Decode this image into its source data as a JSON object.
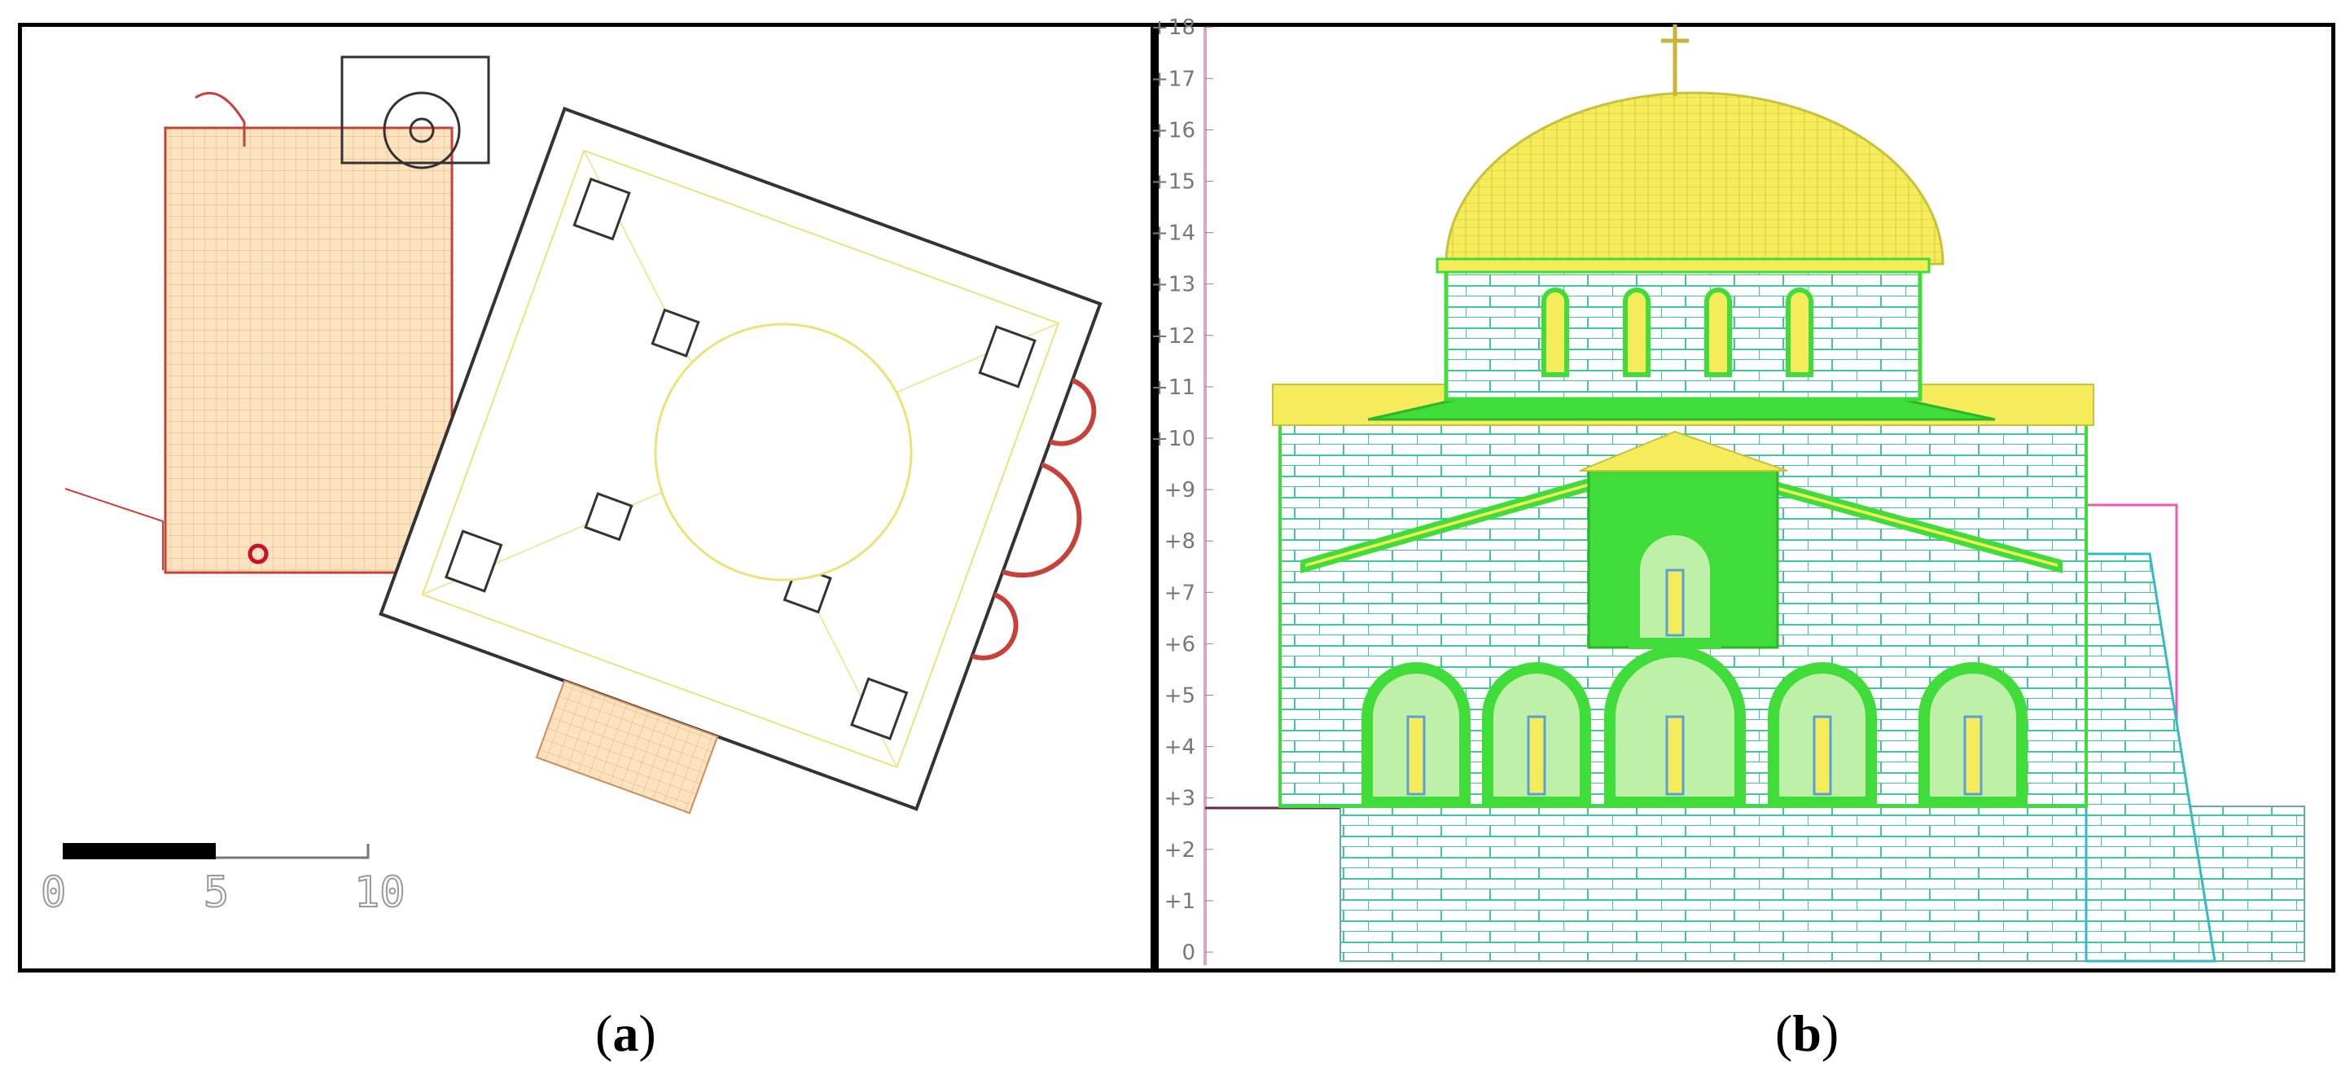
{
  "captions": {
    "a": "a",
    "b": "b"
  },
  "plan": {
    "scale_bar": {
      "labels": [
        "0",
        "5",
        "10"
      ]
    }
  },
  "elevation": {
    "axis_labels": [
      "0",
      "+1",
      "+2",
      "+3",
      "+4",
      "+5",
      "+6",
      "+7",
      "+8",
      "+9",
      "+10",
      "+11",
      "+12",
      "+13",
      "+14",
      "+15",
      "+16",
      "+17",
      "+18"
    ]
  },
  "colors": {
    "yellow": "#f4ec5a",
    "green": "#3fdc3a",
    "cyan": "#35b8c8",
    "pink": "#e85ab4",
    "plan_red": "#c8403a",
    "plan_orange": "#f2c98a"
  }
}
